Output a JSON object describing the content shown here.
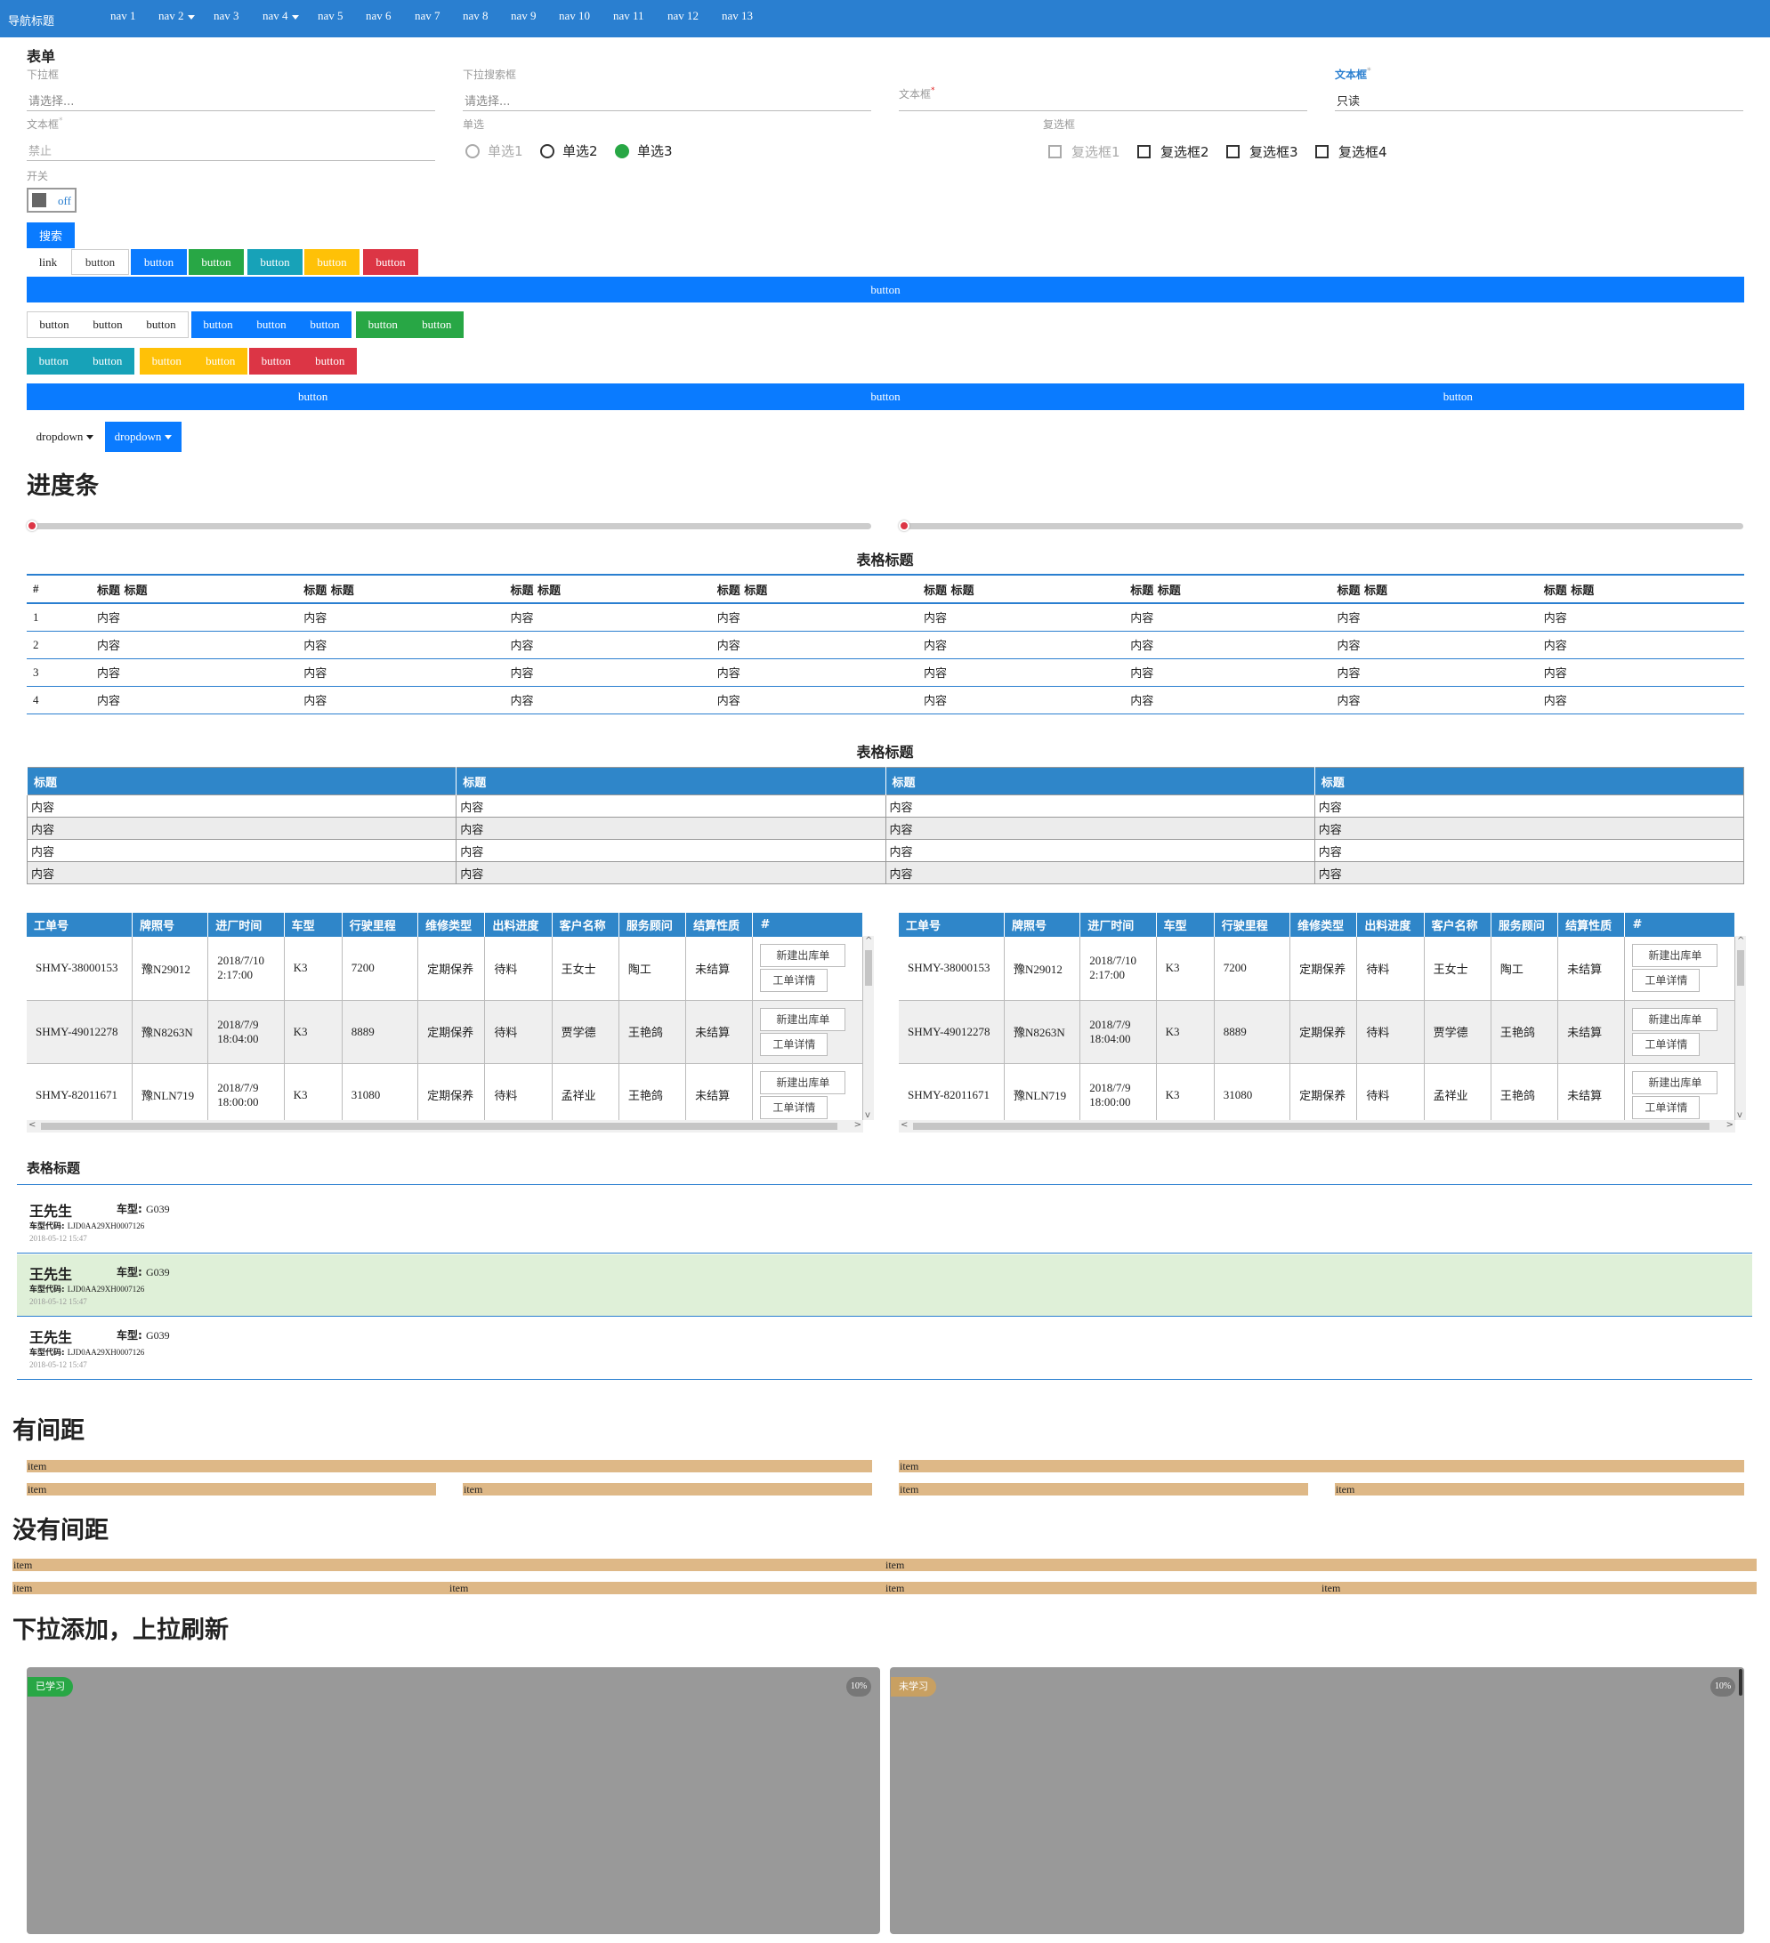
{
  "nav": {
    "brand": "导航标题",
    "items": [
      "nav 1",
      "nav 2",
      "nav 3",
      "nav 4",
      "nav 5",
      "nav 6",
      "nav 7",
      "nav 8",
      "nav 9",
      "nav 10",
      "nav 11",
      "nav 12",
      "nav 13"
    ]
  },
  "form": {
    "title": "表单",
    "dropdown": {
      "label": "下拉框",
      "placeholder": "请选择..."
    },
    "search_dropdown": {
      "label": "下拉搜索框",
      "placeholder": "请选择..."
    },
    "text_field_mid": {
      "label": "文本框"
    },
    "text_field_readonly": {
      "label": "文本框",
      "value": "只读"
    },
    "text_field_disabled": {
      "label": "文本框",
      "value": "禁止"
    },
    "radio": {
      "label": "单选",
      "options": [
        "单选1",
        "单选2",
        "单选3"
      ],
      "selected": "单选3",
      "disabled": "单选1"
    },
    "checkbox": {
      "label": "复选框",
      "options": [
        "复选框1",
        "复选框2",
        "复选框3",
        "复选框4"
      ],
      "disabled": "复选框1"
    },
    "switch": {
      "label": "开关",
      "value": "off"
    },
    "search_button": "搜索"
  },
  "buttons": {
    "row1": [
      "link",
      "button",
      "button",
      "button",
      "button",
      "button",
      "button"
    ],
    "full": "button",
    "group_white": [
      "button",
      "button",
      "button"
    ],
    "group_blue": [
      "button",
      "button",
      "button"
    ],
    "group_green": [
      "button",
      "button"
    ],
    "group_teal": [
      "button",
      "button"
    ],
    "group_yellow": [
      "button",
      "button"
    ],
    "group_red": [
      "button",
      "button"
    ],
    "justified": [
      "button",
      "button",
      "button"
    ],
    "dropdowns": [
      "dropdown",
      "dropdown"
    ]
  },
  "progress": {
    "title": "进度条",
    "values": [
      0,
      0
    ]
  },
  "table1": {
    "title": "表格标题",
    "headers": [
      "#",
      "标题 标题",
      "标题 标题",
      "标题 标题",
      "标题 标题",
      "标题 标题",
      "标题 标题",
      "标题 标题",
      "标题 标题"
    ],
    "rows": [
      [
        "1",
        "内容",
        "内容",
        "内容",
        "内容",
        "内容",
        "内容",
        "内容",
        "内容"
      ],
      [
        "2",
        "内容",
        "内容",
        "内容",
        "内容",
        "内容",
        "内容",
        "内容",
        "内容"
      ],
      [
        "3",
        "内容",
        "内容",
        "内容",
        "内容",
        "内容",
        "内容",
        "内容",
        "内容"
      ],
      [
        "4",
        "内容",
        "内容",
        "内容",
        "内容",
        "内容",
        "内容",
        "内容",
        "内容"
      ]
    ]
  },
  "table2": {
    "title": "表格标题",
    "headers": [
      "标题",
      "标题",
      "标题",
      "标题"
    ],
    "rows": [
      [
        "内容",
        "内容",
        "内容",
        "内容"
      ],
      [
        "内容",
        "内容",
        "内容",
        "内容"
      ],
      [
        "内容",
        "内容",
        "内容",
        "内容"
      ],
      [
        "内容",
        "内容",
        "内容",
        "内容"
      ]
    ]
  },
  "orders": {
    "headers": [
      "工单号",
      "牌照号",
      "进厂时间",
      "车型",
      "行驶里程",
      "维修类型",
      "出料进度",
      "客户名称",
      "服务顾问",
      "结算性质",
      "#"
    ],
    "actions": [
      "新建出库单",
      "工单详情"
    ],
    "rows": [
      [
        "SHMY-38000153",
        "豫N29012",
        "2018/7/10 2:17:00",
        "K3",
        "7200",
        "定期保养",
        "待料",
        "王女士",
        "陶工",
        "未结算"
      ],
      [
        "SHMY-49012278",
        "豫N8263N",
        "2018/7/9 18:04:00",
        "K3",
        "8889",
        "定期保养",
        "待料",
        "贾学德",
        "王艳鸽",
        "未结算"
      ],
      [
        "SHMY-82011671",
        "豫NLN719",
        "2018/7/9 18:00:00",
        "K3",
        "31080",
        "定期保养",
        "待料",
        "孟祥业",
        "王艳鸽",
        "未结算"
      ]
    ]
  },
  "list": {
    "title": "表格标题",
    "items": [
      {
        "name": "王先生",
        "model_label": "车型:",
        "model": "G039",
        "code_label": "车型代码:",
        "code": "LJD0AA29XH0007126",
        "date": "2018-05-12 15:47"
      },
      {
        "name": "王先生",
        "model_label": "车型:",
        "model": "G039",
        "code_label": "车型代码:",
        "code": "LJD0AA29XH0007126",
        "date": "2018-05-12 15:47"
      },
      {
        "name": "王先生",
        "model_label": "车型:",
        "model": "G039",
        "code_label": "车型代码:",
        "code": "LJD0AA29XH0007126",
        "date": "2018-05-12 15:47"
      }
    ]
  },
  "grid_gap": {
    "title": "有间距",
    "row1": [
      "item",
      "item"
    ],
    "row2": [
      "item",
      "item",
      "item",
      "item"
    ]
  },
  "grid_nogap": {
    "title": "没有间距",
    "row1": [
      "item",
      "item"
    ],
    "row2": [
      "item",
      "item",
      "item",
      "item"
    ]
  },
  "pull": {
    "title": "下拉添加，上拉刷新",
    "cards": [
      {
        "badge": "已学习",
        "badge_color": "#28a745",
        "percent": "10%"
      },
      {
        "badge": "未学习",
        "badge_color": "#c8a062",
        "percent": "10%"
      }
    ]
  },
  "colors": {
    "primary": "#0a7bff",
    "nav": "#2a7fd0",
    "success": "#28a745",
    "info": "#17a2b8",
    "warning": "#ffc107",
    "danger": "#dc3545",
    "item": "#deb887"
  }
}
